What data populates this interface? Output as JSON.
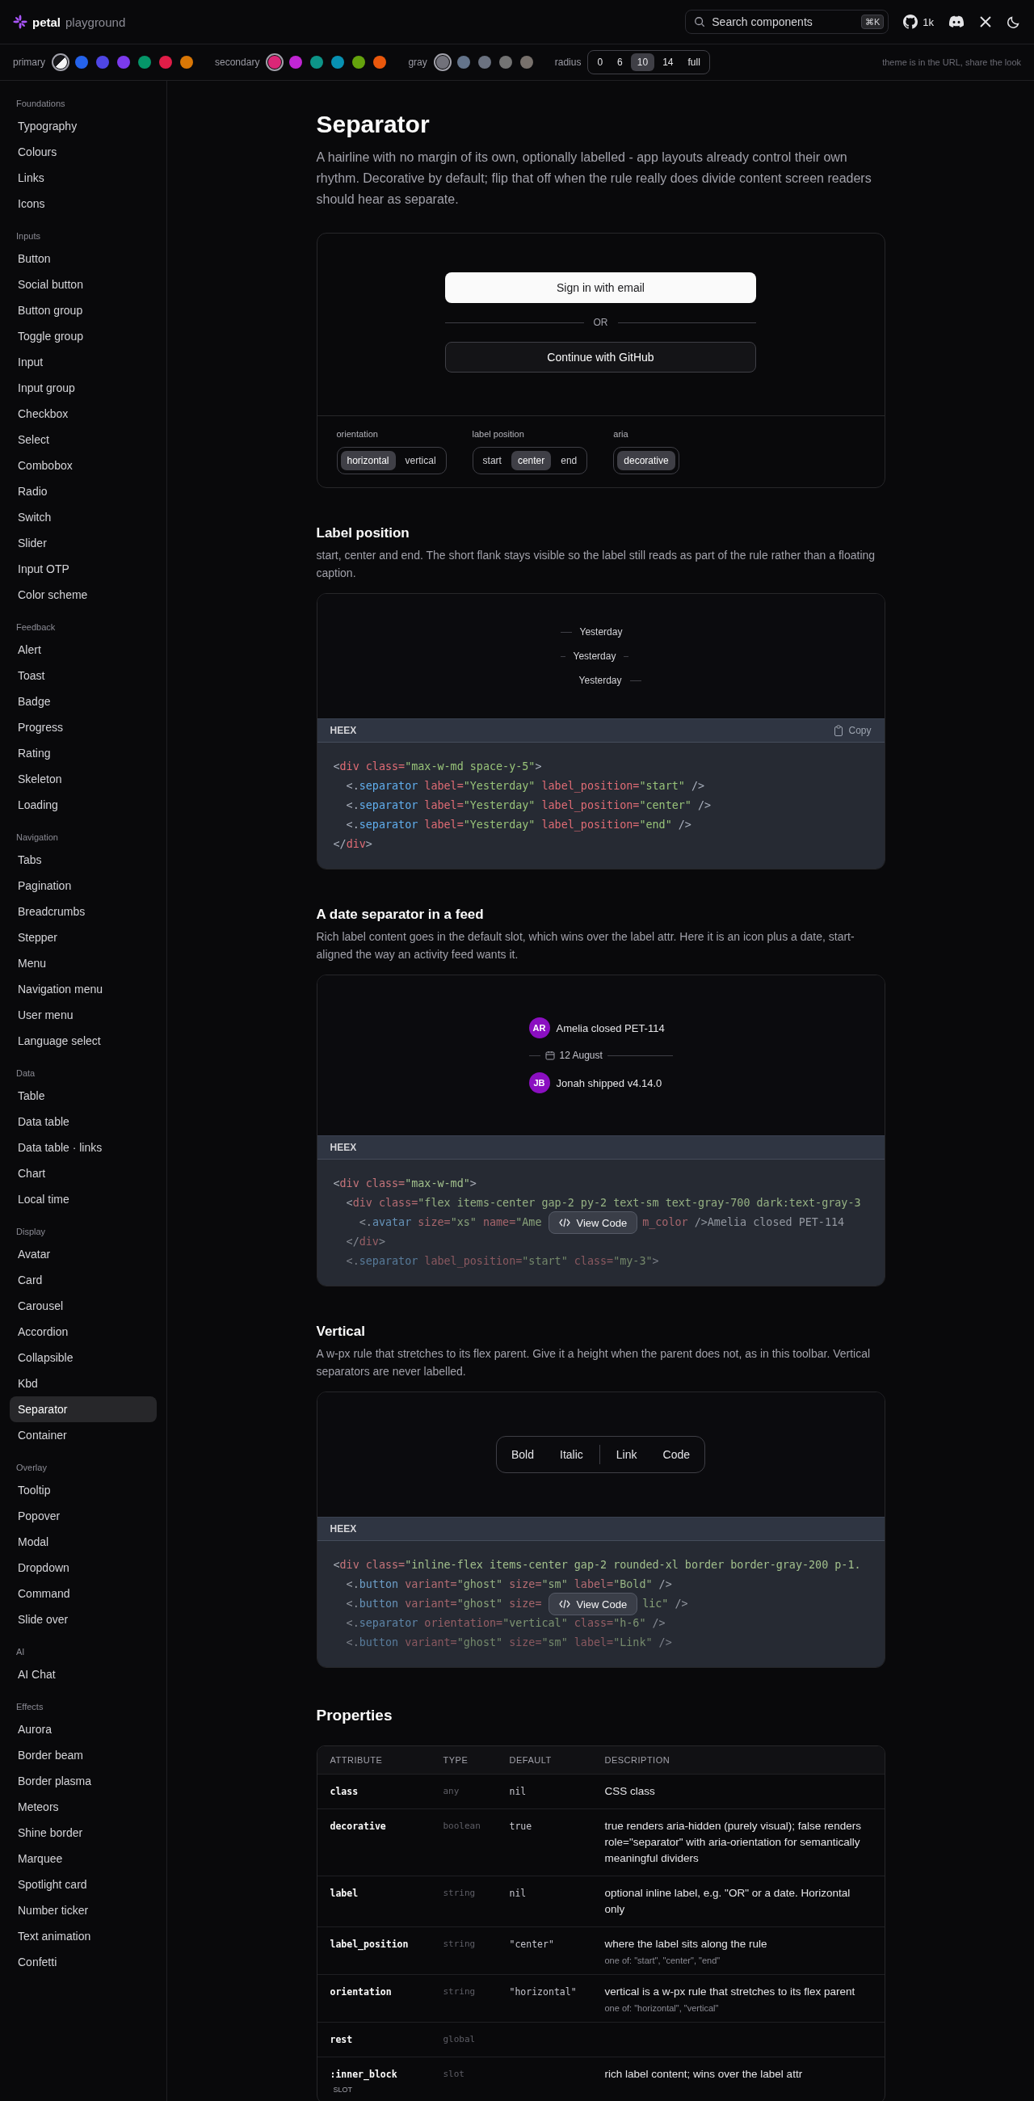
{
  "header": {
    "brand": "petal",
    "subtitle": "playground",
    "search": {
      "placeholder": "Search components",
      "shortcut": "⌘K"
    },
    "github_stars": "1k"
  },
  "theme_bar": {
    "groups": [
      {
        "label": "primary",
        "swatches": [
          {
            "kind": "split",
            "selected": true
          },
          {
            "kind": "solid",
            "color": "#2563eb",
            "selected": false
          },
          {
            "kind": "solid",
            "color": "#4f46e5",
            "selected": false
          },
          {
            "kind": "solid",
            "color": "#7c3aed",
            "selected": false
          },
          {
            "kind": "solid",
            "color": "#059669",
            "selected": false
          },
          {
            "kind": "solid",
            "color": "#e11d48",
            "selected": false
          },
          {
            "kind": "solid",
            "color": "#d97706",
            "selected": false
          }
        ]
      },
      {
        "label": "secondary",
        "swatches": [
          {
            "kind": "solid",
            "color": "#db2777",
            "selected": true
          },
          {
            "kind": "solid",
            "color": "#c026d3",
            "selected": false
          },
          {
            "kind": "solid",
            "color": "#0d9488",
            "selected": false
          },
          {
            "kind": "solid",
            "color": "#0891b2",
            "selected": false
          },
          {
            "kind": "solid",
            "color": "#65a30d",
            "selected": false
          },
          {
            "kind": "solid",
            "color": "#ea580c",
            "selected": false
          }
        ]
      },
      {
        "label": "gray",
        "swatches": [
          {
            "kind": "solid",
            "color": "#71717a",
            "selected": true
          },
          {
            "kind": "solid",
            "color": "#64748b",
            "selected": false
          },
          {
            "kind": "solid",
            "color": "#6b7280",
            "selected": false
          },
          {
            "kind": "solid",
            "color": "#737373",
            "selected": false
          },
          {
            "kind": "solid",
            "color": "#78716c",
            "selected": false
          }
        ]
      }
    ],
    "radius": {
      "label": "radius",
      "options": [
        {
          "label": "0",
          "selected": false
        },
        {
          "label": "6",
          "selected": false
        },
        {
          "label": "10",
          "selected": true
        },
        {
          "label": "14",
          "selected": false
        },
        {
          "label": "full",
          "selected": false
        }
      ]
    },
    "hint": "theme is in the URL, share the look"
  },
  "sidebar": {
    "groups": [
      {
        "heading": "Foundations",
        "items": [
          {
            "label": "Typography",
            "selected": false
          },
          {
            "label": "Colours",
            "selected": false
          },
          {
            "label": "Links",
            "selected": false
          },
          {
            "label": "Icons",
            "selected": false
          }
        ]
      },
      {
        "heading": "Inputs",
        "items": [
          {
            "label": "Button",
            "selected": false
          },
          {
            "label": "Social button",
            "selected": false
          },
          {
            "label": "Button group",
            "selected": false
          },
          {
            "label": "Toggle group",
            "selected": false
          },
          {
            "label": "Input",
            "selected": false
          },
          {
            "label": "Input group",
            "selected": false
          },
          {
            "label": "Checkbox",
            "selected": false
          },
          {
            "label": "Select",
            "selected": false
          },
          {
            "label": "Combobox",
            "selected": false
          },
          {
            "label": "Radio",
            "selected": false
          },
          {
            "label": "Switch",
            "selected": false
          },
          {
            "label": "Slider",
            "selected": false
          },
          {
            "label": "Input OTP",
            "selected": false
          },
          {
            "label": "Color scheme",
            "selected": false
          }
        ]
      },
      {
        "heading": "Feedback",
        "items": [
          {
            "label": "Alert",
            "selected": false
          },
          {
            "label": "Toast",
            "selected": false
          },
          {
            "label": "Badge",
            "selected": false
          },
          {
            "label": "Progress",
            "selected": false
          },
          {
            "label": "Rating",
            "selected": false
          },
          {
            "label": "Skeleton",
            "selected": false
          },
          {
            "label": "Loading",
            "selected": false
          }
        ]
      },
      {
        "heading": "Navigation",
        "items": [
          {
            "label": "Tabs",
            "selected": false
          },
          {
            "label": "Pagination",
            "selected": false
          },
          {
            "label": "Breadcrumbs",
            "selected": false
          },
          {
            "label": "Stepper",
            "selected": false
          },
          {
            "label": "Menu",
            "selected": false
          },
          {
            "label": "Navigation menu",
            "selected": false
          },
          {
            "label": "User menu",
            "selected": false
          },
          {
            "label": "Language select",
            "selected": false
          }
        ]
      },
      {
        "heading": "Data",
        "items": [
          {
            "label": "Table",
            "selected": false
          },
          {
            "label": "Data table",
            "selected": false
          },
          {
            "label": "Data table · links",
            "selected": false
          },
          {
            "label": "Chart",
            "selected": false
          },
          {
            "label": "Local time",
            "selected": false
          }
        ]
      },
      {
        "heading": "Display",
        "items": [
          {
            "label": "Avatar",
            "selected": false
          },
          {
            "label": "Card",
            "selected": false
          },
          {
            "label": "Carousel",
            "selected": false
          },
          {
            "label": "Accordion",
            "selected": false
          },
          {
            "label": "Collapsible",
            "selected": false
          },
          {
            "label": "Kbd",
            "selected": false
          },
          {
            "label": "Separator",
            "selected": true
          },
          {
            "label": "Container",
            "selected": false
          }
        ]
      },
      {
        "heading": "Overlay",
        "items": [
          {
            "label": "Tooltip",
            "selected": false
          },
          {
            "label": "Popover",
            "selected": false
          },
          {
            "label": "Modal",
            "selected": false
          },
          {
            "label": "Dropdown",
            "selected": false
          },
          {
            "label": "Command",
            "selected": false
          },
          {
            "label": "Slide over",
            "selected": false
          }
        ]
      },
      {
        "heading": "AI",
        "items": [
          {
            "label": "AI Chat",
            "selected": false
          }
        ]
      },
      {
        "heading": "Effects",
        "items": [
          {
            "label": "Aurora",
            "selected": false
          },
          {
            "label": "Border beam",
            "selected": false
          },
          {
            "label": "Border plasma",
            "selected": false
          },
          {
            "label": "Meteors",
            "selected": false
          },
          {
            "label": "Shine border",
            "selected": false
          },
          {
            "label": "Marquee",
            "selected": false
          },
          {
            "label": "Spotlight card",
            "selected": false
          },
          {
            "label": "Number ticker",
            "selected": false
          },
          {
            "label": "Text animation",
            "selected": false
          },
          {
            "label": "Confetti",
            "selected": false
          }
        ]
      }
    ]
  },
  "page": {
    "title": "Separator",
    "description": "A hairline with no margin of its own, optionally labelled - app layouts already control their own rhythm. Decorative by default; flip that off when the rule really does divide content screen readers should hear as separate."
  },
  "hero_demo": {
    "buttons": [
      {
        "label": "Sign in with email",
        "kind": "solid"
      },
      {
        "label": "Continue with GitHub",
        "kind": "outline"
      }
    ],
    "separator_label": "OR",
    "controls": [
      {
        "label": "orientation",
        "options": [
          {
            "label": "horizontal",
            "selected": true
          },
          {
            "label": "vertical",
            "selected": false
          }
        ]
      },
      {
        "label": "label position",
        "options": [
          {
            "label": "start",
            "selected": false
          },
          {
            "label": "center",
            "selected": true
          },
          {
            "label": "end",
            "selected": false
          }
        ]
      },
      {
        "label": "aria",
        "options": [
          {
            "label": "decorative",
            "selected": true
          }
        ]
      }
    ]
  },
  "sections": [
    {
      "heading": "Label position",
      "description": "start, center and end. The short flank stays visible so the label still reads as part of the rule rather than a floating caption.",
      "preview": {
        "kind": "label_positions",
        "rows": [
          {
            "label": "Yesterday",
            "kind": "start"
          },
          {
            "label": "Yesterday",
            "kind": "center"
          },
          {
            "label": "Yesterday",
            "kind": "end"
          }
        ]
      },
      "code": {
        "language": "HEEX",
        "copy": "Copy",
        "collapsed": false,
        "lines": [
          {
            "tokens": [
              {
                "kind": "plain",
                "text": "<"
              },
              {
                "kind": "tag",
                "text": "div"
              },
              {
                "kind": "attr",
                "text": " class="
              },
              {
                "kind": "string",
                "text": "\"max-w-md space-y-5\""
              },
              {
                "kind": "plain",
                "text": ">"
              }
            ]
          },
          {
            "tokens": [
              {
                "kind": "plain",
                "text": "  <."
              },
              {
                "kind": "comp",
                "text": "separator"
              },
              {
                "kind": "attr",
                "text": " label="
              },
              {
                "kind": "string",
                "text": "\"Yesterday\""
              },
              {
                "kind": "attr",
                "text": " label_position="
              },
              {
                "kind": "string",
                "text": "\"start\""
              },
              {
                "kind": "plain",
                "text": " />"
              }
            ]
          },
          {
            "tokens": [
              {
                "kind": "plain",
                "text": "  <."
              },
              {
                "kind": "comp",
                "text": "separator"
              },
              {
                "kind": "attr",
                "text": " label="
              },
              {
                "kind": "string",
                "text": "\"Yesterday\""
              },
              {
                "kind": "attr",
                "text": " label_position="
              },
              {
                "kind": "string",
                "text": "\"center\""
              },
              {
                "kind": "plain",
                "text": " />"
              }
            ]
          },
          {
            "tokens": [
              {
                "kind": "plain",
                "text": "  <."
              },
              {
                "kind": "comp",
                "text": "separator"
              },
              {
                "kind": "attr",
                "text": " label="
              },
              {
                "kind": "string",
                "text": "\"Yesterday\""
              },
              {
                "kind": "attr",
                "text": " label_position="
              },
              {
                "kind": "string",
                "text": "\"end\""
              },
              {
                "kind": "plain",
                "text": " />"
              }
            ]
          },
          {
            "tokens": [
              {
                "kind": "plain",
                "text": "</"
              },
              {
                "kind": "tag",
                "text": "div"
              },
              {
                "kind": "plain",
                "text": ">"
              }
            ]
          }
        ]
      }
    },
    {
      "heading": "A date separator in a feed",
      "description": "Rich label content goes in the default slot, which wins over the label attr. Here it is an icon plus a date, start-aligned the way an activity feed wants it.",
      "preview": {
        "kind": "feed",
        "items": [
          {
            "kind": "event",
            "initials": "AR",
            "text": "Amelia closed PET-114"
          },
          {
            "kind": "date",
            "label": "12 August"
          },
          {
            "kind": "event",
            "initials": "JB",
            "text": "Jonah shipped v4.14.0"
          }
        ]
      },
      "code": {
        "language": "HEEX",
        "collapsed": true,
        "view_code": "View Code",
        "lines": [
          {
            "tokens": [
              {
                "kind": "plain",
                "text": "<"
              },
              {
                "kind": "tag",
                "text": "div"
              },
              {
                "kind": "attr",
                "text": " class="
              },
              {
                "kind": "string",
                "text": "\"max-w-md\""
              },
              {
                "kind": "plain",
                "text": ">"
              }
            ]
          },
          {
            "tokens": [
              {
                "kind": "plain",
                "text": "  <"
              },
              {
                "kind": "tag",
                "text": "div"
              },
              {
                "kind": "attr",
                "text": " class="
              },
              {
                "kind": "string",
                "text": "\"flex items-center gap-2 py-2 text-sm text-gray-700 dark:text-gray-3"
              }
            ]
          },
          {
            "tokens": [
              {
                "kind": "plain",
                "text": "    <."
              },
              {
                "kind": "comp",
                "text": "avatar"
              },
              {
                "kind": "attr",
                "text": " size="
              },
              {
                "kind": "string",
                "text": "\"xs\""
              },
              {
                "kind": "attr",
                "text": " name="
              },
              {
                "kind": "string",
                "text": "\"Ame"
              }
            ],
            "after": [
              {
                "kind": "attr",
                "text": "m_color"
              },
              {
                "kind": "plain",
                "text": " />Amelia closed PET-114"
              }
            ]
          },
          {
            "tokens": [
              {
                "kind": "plain",
                "text": "  </"
              },
              {
                "kind": "tag",
                "text": "div"
              },
              {
                "kind": "plain",
                "text": ">"
              }
            ]
          },
          {
            "tokens": [
              {
                "kind": "plain",
                "text": "  <."
              },
              {
                "kind": "comp",
                "text": "separator"
              },
              {
                "kind": "attr",
                "text": " label_position="
              },
              {
                "kind": "string",
                "text": "\"start\""
              },
              {
                "kind": "attr",
                "text": " class="
              },
              {
                "kind": "string",
                "text": "\"my-3\""
              },
              {
                "kind": "plain",
                "text": ">"
              }
            ]
          }
        ]
      }
    },
    {
      "heading": "Vertical",
      "description": "A w-px rule that stretches to its flex parent. Give it a height when the parent does not, as in this toolbar. Vertical separators are never labelled.",
      "preview": {
        "kind": "toolbar",
        "items": [
          {
            "kind": "button",
            "label": "Bold"
          },
          {
            "kind": "button",
            "label": "Italic"
          },
          {
            "kind": "separator"
          },
          {
            "kind": "button",
            "label": "Link"
          },
          {
            "kind": "button",
            "label": "Code"
          }
        ]
      },
      "code": {
        "language": "HEEX",
        "collapsed": true,
        "view_code": "View Code",
        "lines": [
          {
            "tokens": [
              {
                "kind": "plain",
                "text": "<"
              },
              {
                "kind": "tag",
                "text": "div"
              },
              {
                "kind": "attr",
                "text": " class="
              },
              {
                "kind": "string",
                "text": "\"inline-flex items-center gap-2 rounded-xl border border-gray-200 p-1."
              }
            ]
          },
          {
            "tokens": [
              {
                "kind": "plain",
                "text": "  <."
              },
              {
                "kind": "comp",
                "text": "button"
              },
              {
                "kind": "attr",
                "text": " variant="
              },
              {
                "kind": "string",
                "text": "\"ghost\""
              },
              {
                "kind": "attr",
                "text": " size="
              },
              {
                "kind": "string",
                "text": "\"sm\""
              },
              {
                "kind": "attr",
                "text": " label="
              },
              {
                "kind": "string",
                "text": "\"Bold\""
              },
              {
                "kind": "plain",
                "text": " />"
              }
            ]
          },
          {
            "tokens": [
              {
                "kind": "plain",
                "text": "  <."
              },
              {
                "kind": "comp",
                "text": "button"
              },
              {
                "kind": "attr",
                "text": " variant="
              },
              {
                "kind": "string",
                "text": "\"ghost\""
              },
              {
                "kind": "attr",
                "text": " size="
              }
            ],
            "after": [
              {
                "kind": "string",
                "text": "lic\""
              },
              {
                "kind": "plain",
                "text": " />"
              }
            ]
          },
          {
            "tokens": [
              {
                "kind": "plain",
                "text": "  <."
              },
              {
                "kind": "comp",
                "text": "separator"
              },
              {
                "kind": "attr",
                "text": " orientation="
              },
              {
                "kind": "string",
                "text": "\"vertical\""
              },
              {
                "kind": "attr",
                "text": " class="
              },
              {
                "kind": "string",
                "text": "\"h-6\""
              },
              {
                "kind": "plain",
                "text": " />"
              }
            ]
          },
          {
            "tokens": [
              {
                "kind": "plain",
                "text": "  <."
              },
              {
                "kind": "comp",
                "text": "button"
              },
              {
                "kind": "attr",
                "text": " variant="
              },
              {
                "kind": "string",
                "text": "\"ghost\""
              },
              {
                "kind": "attr",
                "text": " size="
              },
              {
                "kind": "string",
                "text": "\"sm\""
              },
              {
                "kind": "attr",
                "text": " label="
              },
              {
                "kind": "string",
                "text": "\"Link\""
              },
              {
                "kind": "plain",
                "text": " />"
              }
            ]
          }
        ]
      }
    }
  ],
  "properties": {
    "heading": "Properties",
    "columns": [
      "ATTRIBUTE",
      "TYPE",
      "DEFAULT",
      "DESCRIPTION"
    ],
    "rows": [
      {
        "attribute": "class",
        "type": "any",
        "default": "nil",
        "description": "CSS class"
      },
      {
        "attribute": "decorative",
        "type": "boolean",
        "default": "true",
        "description": "true renders aria-hidden (purely visual); false renders role=\"separator\" with aria-orientation for semantically meaningful dividers"
      },
      {
        "attribute": "label",
        "type": "string",
        "default": "nil",
        "description": "optional inline label, e.g. \"OR\" or a date. Horizontal only"
      },
      {
        "attribute": "label_position",
        "type": "string",
        "default": "\"center\"",
        "description": "where the label sits along the rule",
        "note": "one of: \"start\", \"center\", \"end\""
      },
      {
        "attribute": "orientation",
        "type": "string",
        "default": "\"horizontal\"",
        "description": "vertical is a w-px rule that stretches to its flex parent",
        "note": "one of: \"horizontal\", \"vertical\""
      },
      {
        "attribute": "rest",
        "type": "global"
      },
      {
        "attribute": ":inner_block",
        "badge": "SLOT",
        "type": "slot",
        "description": "rich label content; wins over the label attr"
      }
    ]
  }
}
